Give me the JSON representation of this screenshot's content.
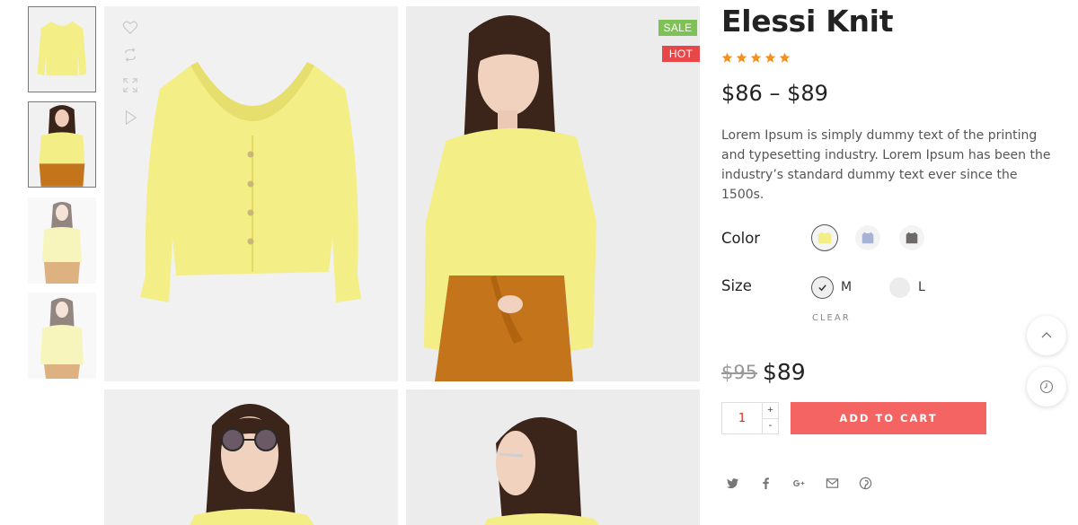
{
  "product": {
    "title": "Elessi Knit",
    "rating_stars": 5,
    "price_range": "$86 – $89",
    "description": "Lorem Ipsum is simply dummy text of the printing and typesetting industry. Lorem Ipsum has been the industry’s standard dummy text ever since the 1500s.",
    "old_price": "$95",
    "price": "$89"
  },
  "badges": {
    "sale": "SALE",
    "hot": "HOT"
  },
  "gallery": {
    "side_icons": [
      "heart-icon",
      "compare-icon",
      "expand-icon",
      "play-icon"
    ]
  },
  "attributes": {
    "color_label": "Color",
    "colors": [
      "yellow",
      "lavender",
      "grey"
    ],
    "size_label": "Size",
    "sizes": [
      "M",
      "L"
    ],
    "selected_size": "M",
    "clear_label": "CLEAR"
  },
  "cart": {
    "quantity": "1",
    "plus": "+",
    "minus": "-",
    "add_label": "ADD TO CART"
  },
  "share_icons": [
    "twitter-icon",
    "facebook-icon",
    "google-plus-icon",
    "email-icon",
    "pinterest-icon"
  ],
  "colors": {
    "accent": "#f36462",
    "star": "#f5901e",
    "sale_badge": "#7ec255",
    "hot_badge": "#e8474a",
    "knit_yellow": "#f3ee86",
    "pants_orange": "#c4741a",
    "hair": "#3b2419"
  }
}
